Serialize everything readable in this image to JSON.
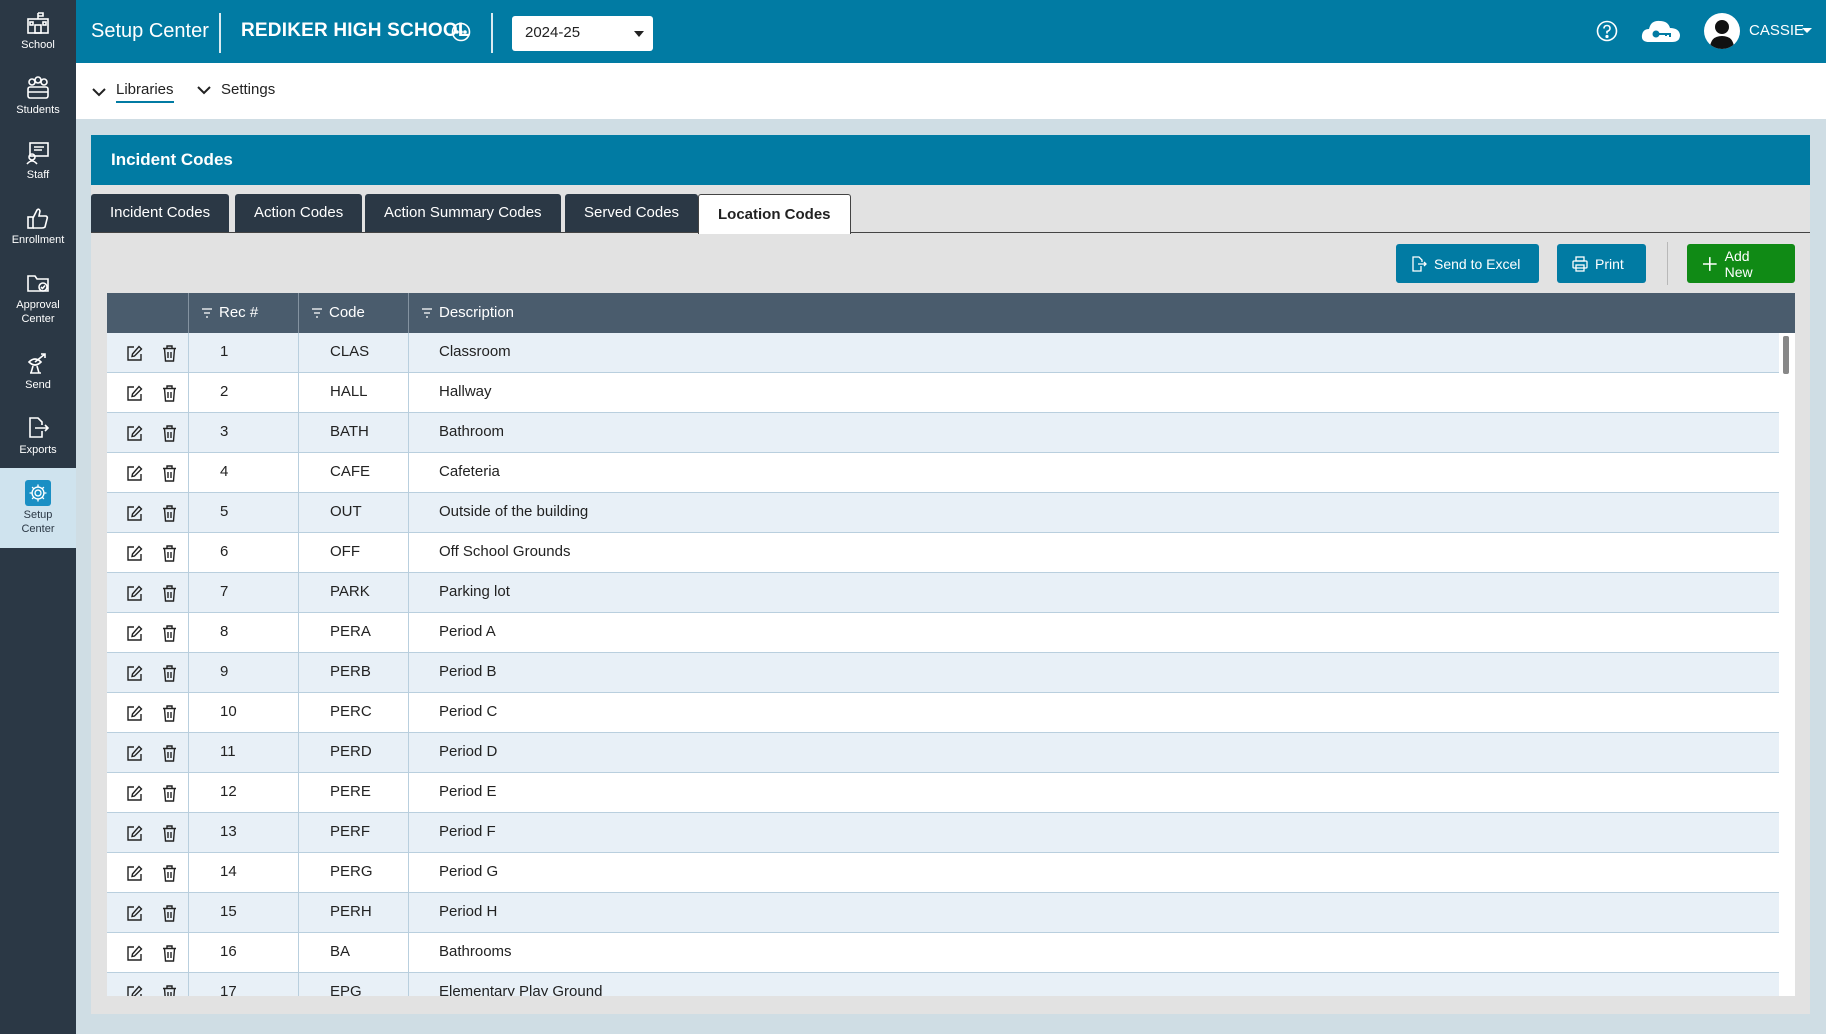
{
  "sidebar": {
    "items": [
      {
        "label": "School",
        "icon": "school-icon"
      },
      {
        "label": "Students",
        "icon": "students-icon"
      },
      {
        "label": "Staff",
        "icon": "staff-icon"
      },
      {
        "label": "Enrollment",
        "icon": "thumbs-up-icon"
      },
      {
        "label": "Approval Center",
        "icon": "folder-check-icon"
      },
      {
        "label": "Send",
        "icon": "send-icon"
      },
      {
        "label": "Exports",
        "icon": "export-icon"
      },
      {
        "label": "Setup Center",
        "icon": "gear-icon",
        "active": true
      }
    ]
  },
  "topbar": {
    "title": "Setup Center",
    "school": "REDIKER HIGH SCHOOL",
    "year": "2024-25",
    "user": "CASSIE"
  },
  "subnav": {
    "libraries": "Libraries",
    "settings": "Settings"
  },
  "panel": {
    "title": "Incident Codes",
    "tabs": [
      "Incident Codes",
      "Action Codes",
      "Action Summary Codes",
      "Served Codes",
      "Location Codes"
    ],
    "active_tab": "Location Codes",
    "buttons": {
      "excel": "Send to Excel",
      "print": "Print",
      "add": "Add New"
    }
  },
  "table": {
    "columns": [
      "Rec #",
      "Code",
      "Description"
    ],
    "rows": [
      {
        "rec": "1",
        "code": "CLAS",
        "desc": "Classroom"
      },
      {
        "rec": "2",
        "code": "HALL",
        "desc": "Hallway"
      },
      {
        "rec": "3",
        "code": "BATH",
        "desc": "Bathroom"
      },
      {
        "rec": "4",
        "code": "CAFE",
        "desc": "Cafeteria"
      },
      {
        "rec": "5",
        "code": "OUT",
        "desc": "Outside of the building"
      },
      {
        "rec": "6",
        "code": "OFF",
        "desc": "Off School Grounds"
      },
      {
        "rec": "7",
        "code": "PARK",
        "desc": "Parking lot"
      },
      {
        "rec": "8",
        "code": "PERA",
        "desc": "Period A"
      },
      {
        "rec": "9",
        "code": "PERB",
        "desc": "Period B"
      },
      {
        "rec": "10",
        "code": "PERC",
        "desc": "Period C"
      },
      {
        "rec": "11",
        "code": "PERD",
        "desc": "Period D"
      },
      {
        "rec": "12",
        "code": "PERE",
        "desc": "Period E"
      },
      {
        "rec": "13",
        "code": "PERF",
        "desc": "Period F"
      },
      {
        "rec": "14",
        "code": "PERG",
        "desc": "Period G"
      },
      {
        "rec": "15",
        "code": "PERH",
        "desc": "Period H"
      },
      {
        "rec": "16",
        "code": "BA",
        "desc": "Bathrooms"
      },
      {
        "rec": "17",
        "code": "EPG",
        "desc": "Elementary Play Ground"
      }
    ]
  },
  "colors": {
    "brand": "#017ba3",
    "sidebar": "#2b3845",
    "add_button": "#108a15",
    "table_header": "#4a5c6d"
  }
}
